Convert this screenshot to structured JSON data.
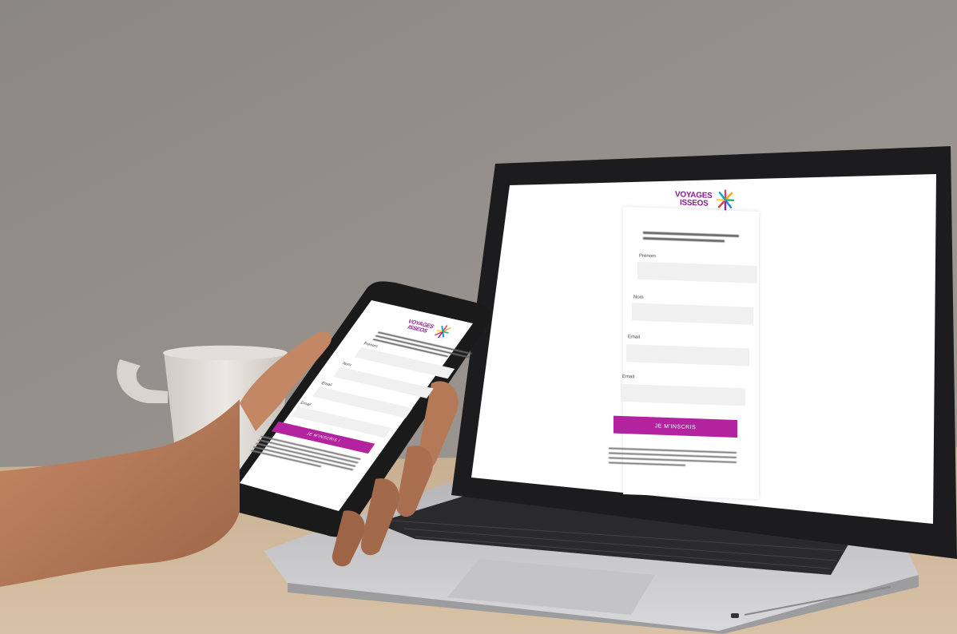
{
  "scene": {
    "description_objects": [
      "wall",
      "table",
      "coffee-cup",
      "laptop",
      "smartphone",
      "hand"
    ],
    "colors": {
      "wall": "#8f8a86",
      "table": "#cdb394",
      "laptop_body": "#c9c9cb",
      "screen_bg": "#ffffff",
      "accent": "#b4239f",
      "field_bg": "#f0f0f0",
      "skin": "#b97e5c"
    }
  },
  "laptop": {
    "brand_line1": "VOYAGES",
    "brand_line2": "ISSEOS",
    "fields": [
      {
        "label": "Prénom",
        "value": ""
      },
      {
        "label": "Nom",
        "value": ""
      },
      {
        "label": "Email",
        "value": ""
      },
      {
        "label": "Email",
        "value": ""
      }
    ],
    "submit_label": "JE M'INSCRIS"
  },
  "phone": {
    "brand_line1": "VOYAGES",
    "brand_line2": "ISSEOS",
    "fields": [
      {
        "label": "Prénom",
        "value": ""
      },
      {
        "label": "Nom",
        "value": ""
      },
      {
        "label": "Email",
        "value": ""
      },
      {
        "label": "Email",
        "value": ""
      }
    ],
    "submit_label": "JE M'INSCRIS !"
  }
}
